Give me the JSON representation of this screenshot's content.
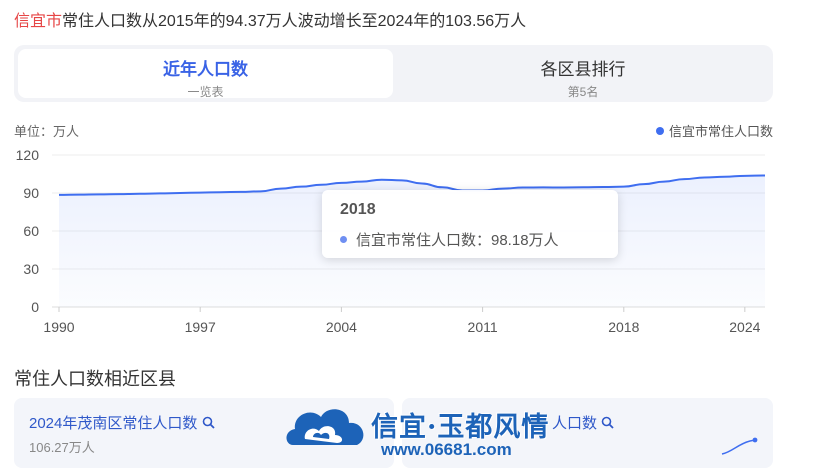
{
  "headline": {
    "city": "信宜市",
    "text": "常住人口数从2015年的94.37万人波动增长至2024年的103.56万人"
  },
  "tabs": [
    {
      "label": "近年人口数",
      "sub": "一览表"
    },
    {
      "label": "各区县排行",
      "sub": "第5名"
    }
  ],
  "chart": {
    "unit_label": "单位：万人",
    "legend_label": "信宜市常住人口数"
  },
  "tooltip": {
    "year": "2018",
    "label": "信宜市常住人口数：98.18万人"
  },
  "section_title": "常住人口数相近区县",
  "cards": [
    {
      "title": "2024年茂南区常住人口数",
      "value": "106.27万人"
    },
    {
      "title": "人口数"
    }
  ],
  "watermark": {
    "line1": "信宜·玉都风情",
    "line2": "www.06681.com"
  },
  "icons": {
    "search": "search-icon",
    "logo": "cloud-logo-icon"
  },
  "colors": {
    "accent": "#3a63e6",
    "line": "#3f6ef0",
    "city": "#e64545"
  },
  "chart_data": {
    "type": "area",
    "ylim": [
      0,
      120
    ],
    "yticks": [
      0,
      30,
      60,
      90,
      120
    ],
    "xticks": [
      1990,
      1997,
      2004,
      2011,
      2018,
      2024
    ],
    "series": [
      {
        "name": "信宜市常住人口数",
        "x": [
          1990,
          1991,
          1992,
          1993,
          1994,
          1995,
          1996,
          1997,
          1998,
          1999,
          2000,
          2001,
          2002,
          2003,
          2004,
          2005,
          2006,
          2007,
          2008,
          2009,
          2010,
          2011,
          2012,
          2013,
          2014,
          2015,
          2016,
          2017,
          2018,
          2019,
          2020,
          2021,
          2022,
          2023,
          2024,
          2025
        ],
        "values": [
          88.5,
          88.7,
          88.9,
          89.1,
          89.4,
          89.7,
          90.0,
          90.3,
          90.6,
          90.9,
          91.3,
          93.5,
          95.0,
          96.5,
          98.0,
          99.0,
          100.5,
          100.0,
          97.5,
          94.5,
          92.0,
          92.0,
          93.5,
          94.3,
          94.4,
          94.37,
          94.5,
          94.7,
          95.0,
          97.0,
          99.0,
          101.0,
          102.2,
          102.8,
          103.56,
          103.8
        ]
      }
    ]
  }
}
